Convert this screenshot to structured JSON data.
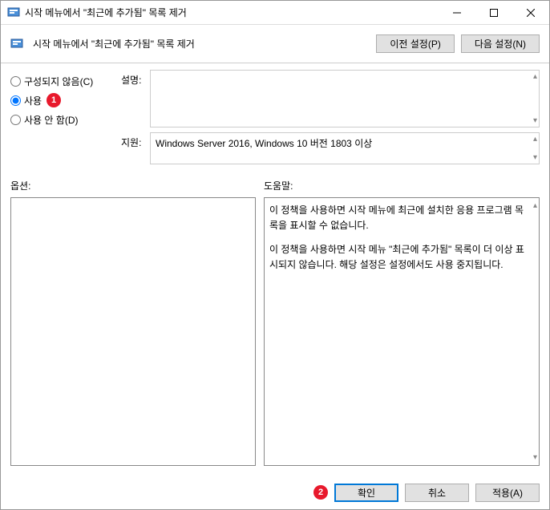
{
  "titlebar": {
    "text": "시작 메뉴에서 \"최근에 추가됨\" 목록 제거"
  },
  "toolbar": {
    "title": "시작 메뉴에서 \"최근에 추가됨\" 목록 제거",
    "prev": "이전 설정(P)",
    "next": "다음 설정(N)"
  },
  "radios": {
    "not_configured": "구성되지 않음(C)",
    "enabled": "사용",
    "disabled": "사용 안 함(D)"
  },
  "markers": {
    "one": "1",
    "two": "2"
  },
  "fields": {
    "description_label": "설명:",
    "description_value": "",
    "support_label": "지원:",
    "support_value": "Windows Server 2016, Windows 10 버전 1803 이상"
  },
  "columns": {
    "options": "옵션:",
    "help": "도움말:"
  },
  "help": {
    "p1": "이 정책을 사용하면 시작 메뉴에 최근에 설치한 응용 프로그램 목록을 표시할 수 없습니다.",
    "p2": "이 정책을 사용하면 시작 메뉴 \"최근에 추가됨\" 목록이 더 이상 표시되지 않습니다. 해당 설정은 설정에서도 사용 중지됩니다."
  },
  "footer": {
    "ok": "확인",
    "cancel": "취소",
    "apply": "적용(A)"
  }
}
